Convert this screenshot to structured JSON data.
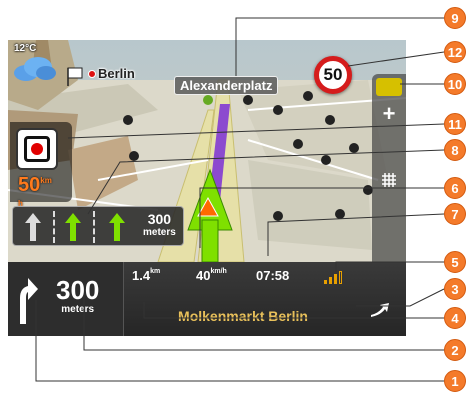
{
  "map": {
    "temperature": "12°C",
    "city_label": "Berlin",
    "street_label": "Alexanderplatz"
  },
  "speed_limit": "50",
  "current_speed": {
    "value": "50",
    "unit": "km/h"
  },
  "lane_assist": {
    "distance_value": "300",
    "distance_unit": "meters"
  },
  "side_panel": {
    "zoom_in": "+",
    "zoom_out": "−"
  },
  "bottom_bar": {
    "turn_distance_value": "300",
    "turn_distance_unit": "meters",
    "remaining_distance": "1.4",
    "remaining_distance_unit": "km",
    "speed": "40",
    "speed_unit": "km/h",
    "arrival_time": "07:58",
    "street_name": "Molkenmarkt  Berlin"
  },
  "callouts": [
    "1",
    "2",
    "3",
    "4",
    "5",
    "6",
    "7",
    "8",
    "9",
    "10",
    "11",
    "12"
  ],
  "colors": {
    "callout": "#f47a2a",
    "route": "#7b2fd6",
    "lane_active": "#7fe000"
  }
}
